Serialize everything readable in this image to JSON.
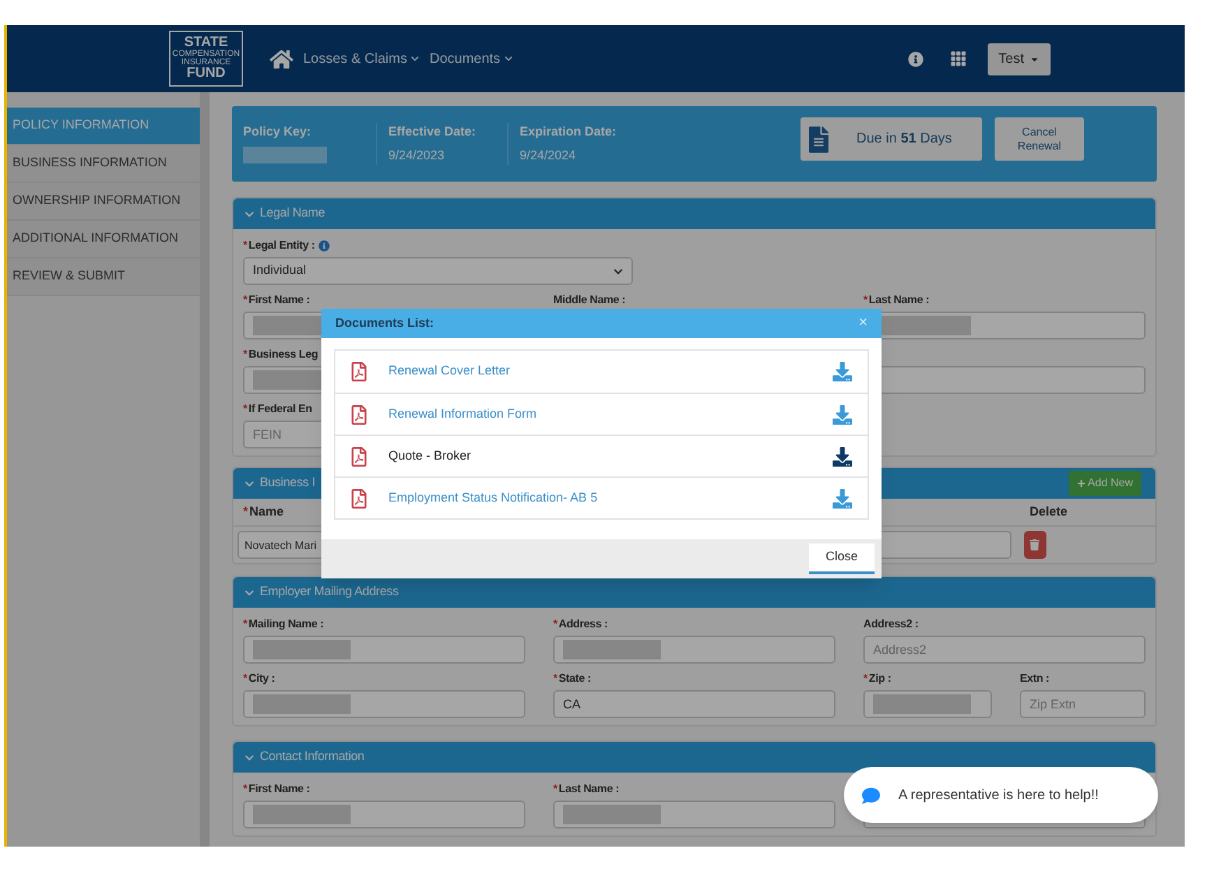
{
  "header": {
    "logo": {
      "top": "STATE",
      "middle": [
        "COMPENSATION",
        "INSURANCE"
      ],
      "bottom": "FUND"
    },
    "nav": [
      {
        "label": "Losses & Claims"
      },
      {
        "label": "Documents"
      }
    ],
    "user_menu": "Test"
  },
  "sidebar": {
    "items": [
      {
        "label": "POLICY INFORMATION",
        "selected": true
      },
      {
        "label": "BUSINESS INFORMATION",
        "selected": false
      },
      {
        "label": "OWNERSHIP INFORMATION",
        "selected": false
      },
      {
        "label": "ADDITIONAL INFORMATION",
        "selected": false
      },
      {
        "label": "REVIEW & SUBMIT",
        "selected": false
      }
    ]
  },
  "policy_banner": {
    "fields": [
      {
        "label": "Policy Key:",
        "redacted": true
      },
      {
        "label": "Effective Date:",
        "value": "9/24/2023",
        "redacted": false
      },
      {
        "label": "Expiration Date:",
        "value": "9/24/2024",
        "redacted": false
      }
    ],
    "due_button": "Due in **51** Days",
    "cancel_button": "Cancel Renewal"
  },
  "legal_name": {
    "title": "Legal Name",
    "rows": [
      [
        {
          "marker": "*",
          "label": "Legal Entity :",
          "info": true,
          "kind": "select",
          "value": "Individual"
        }
      ],
      [
        {
          "marker": "*",
          "label": "First Name :",
          "kind": "input",
          "redacted": true
        },
        {
          "label": "Middle Name :",
          "kind": "label"
        },
        {
          "marker": "*",
          "label": "Last Name :",
          "kind": "input",
          "redacted": true
        }
      ],
      [
        {
          "marker": "*",
          "label": "Business Leg",
          "kind": "input",
          "redacted": true
        },
        {
          "kind": "blank"
        },
        {
          "kind": "input",
          "redacted": false
        }
      ],
      [
        {
          "marker": "*",
          "label": "If Federal En",
          "kind": "input",
          "placeholder": "FEIN",
          "redacted": false
        }
      ]
    ]
  },
  "business": {
    "title": "Business I",
    "add_button": "Add New",
    "columns": [
      {
        "marker": "*",
        "label": "Name"
      },
      {
        "label": "Delete"
      }
    ],
    "row": {
      "name": "Novatech Mari"
    }
  },
  "mailing_address": {
    "title": "Employer Mailing Address",
    "rows": [
      [
        {
          "marker": "*",
          "label": "Mailing Name :",
          "kind": "input",
          "redacted": true
        },
        {
          "marker": "*",
          "label": "Address :",
          "kind": "input",
          "redacted": true
        },
        {
          "label": "Address2 :",
          "kind": "input",
          "placeholder": "Address2",
          "redacted": false
        }
      ],
      [
        {
          "marker": "*",
          "label": "City :",
          "kind": "input",
          "redacted": true
        },
        {
          "marker": "*",
          "label": "State :",
          "kind": "input",
          "value": "CA",
          "redacted": false
        },
        {
          "kind": "pair",
          "items": [
            {
              "marker": "*",
              "label": "Zip :",
              "kind": "input",
              "redacted": true
            },
            {
              "label": "Extn :",
              "kind": "input",
              "placeholder": "Zip Extn",
              "redacted": false
            }
          ]
        }
      ]
    ]
  },
  "contact_information": {
    "title": "Contact Information",
    "rows": [
      [
        {
          "marker": "*",
          "label": "First Name :",
          "kind": "input",
          "redacted": true
        },
        {
          "marker": "*",
          "label": "Last Name :",
          "kind": "input",
          "redacted": true
        },
        {
          "kind": "input",
          "redacted": false
        }
      ]
    ]
  },
  "documents_dialog": {
    "title": "Documents List:",
    "close_icon": "×",
    "items": [
      {
        "label": "Renewal Cover Letter",
        "hovered": false
      },
      {
        "label": "Renewal Information Form",
        "hovered": false
      },
      {
        "label": "Quote - Broker",
        "hovered": true
      },
      {
        "label": "Employment Status Notification- AB 5",
        "hovered": false
      }
    ],
    "close_button": "Close"
  },
  "chat_bubble": "A representative is here to help!!"
}
